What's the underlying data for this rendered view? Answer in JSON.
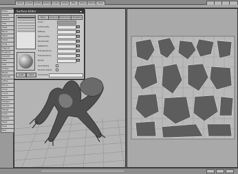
{
  "menu": {
    "tabs": [
      "Items",
      "Create",
      "Modify",
      "Multiply",
      "Construct",
      "Detail",
      "Map",
      "Setup",
      "Utilities",
      "View"
    ]
  },
  "toolbar": {
    "buttons": [
      "Move",
      "Rotate",
      "Stretch",
      "Size",
      "Twist",
      "Bend",
      "Taper",
      "Shear",
      "Drag",
      "Magnet",
      "Dragnet",
      "Smooth",
      "Jitter",
      "Pole",
      "Vortex",
      "Bevel",
      "Extrude",
      "Lathe",
      "Mirror",
      "Array",
      "Clone",
      "Points",
      "Polygon",
      "Curves",
      "Merge",
      "Unify",
      "Subdiv",
      "Weld",
      "Fuse",
      "Text"
    ]
  },
  "surface_editor": {
    "title": "Surface Editor",
    "tabs": [
      "Basic",
      "Advanced",
      "Environment",
      "Shaders"
    ],
    "labels": [
      "Color",
      "Luminosity",
      "Diffuse",
      "Specularity",
      "Glossiness",
      "Reflection",
      "Transparency",
      "Translucency",
      "Bump",
      "Smoothing",
      "Double Sided",
      "Comment"
    ],
    "buttons": [
      "Load",
      "Save",
      "Rename",
      "Display"
    ]
  }
}
